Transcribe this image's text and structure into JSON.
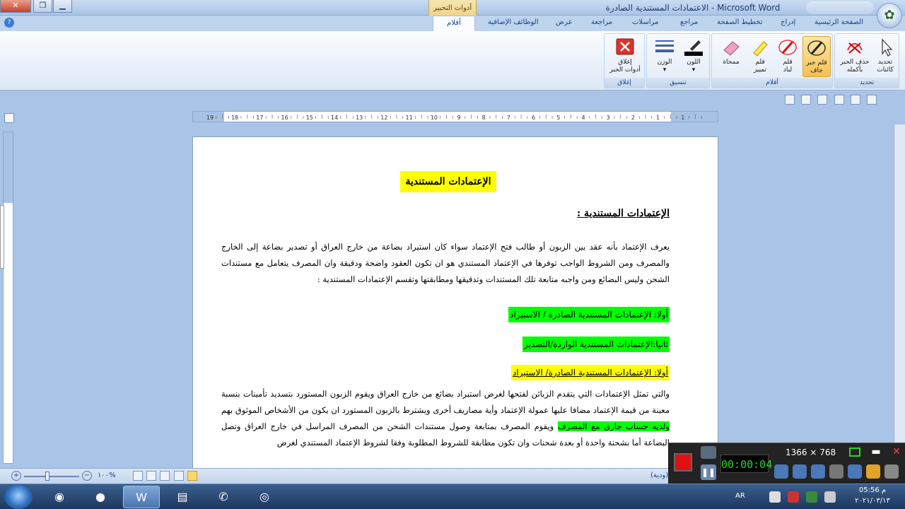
{
  "window": {
    "title": "الاعتمادات المستندية الصادرة - Microsoft Word",
    "close_glyph": "✕",
    "restore_glyph": "❐",
    "minimize_glyph": "▁",
    "contextual_group": "أدوات التحبير"
  },
  "ribbon": {
    "tabs": [
      {
        "label": "الصفحة الرئيسية"
      },
      {
        "label": "إدراج"
      },
      {
        "label": "تخطيط الصفحة"
      },
      {
        "label": "مراجع"
      },
      {
        "label": "مراسلات"
      },
      {
        "label": "مراجعة"
      },
      {
        "label": "عرض"
      },
      {
        "label": "الوظائف الإضافية"
      }
    ],
    "active_tab": "أقلام",
    "groups": {
      "select": {
        "label": "تحديد",
        "buttons": [
          {
            "label_1": "تحديد",
            "label_2": "كائنات",
            "icon": "arrow-select-icon"
          },
          {
            "label_1": "حذف الحبر",
            "label_2": "بأكمله",
            "icon": "erase-ink-icon"
          }
        ]
      },
      "pens": {
        "label": "أقلام",
        "buttons": [
          {
            "label_1": "قلم حبر",
            "label_2": "جاف",
            "icon": "ballpoint-pen-icon",
            "active": true
          },
          {
            "label_1": "قلم",
            "label_2": "لباد",
            "icon": "felt-pen-icon"
          },
          {
            "label_1": "قلم",
            "label_2": "تمييز",
            "icon": "highlighter-icon"
          },
          {
            "label_1": "ممحاة",
            "label_2": "",
            "icon": "eraser-icon"
          }
        ]
      },
      "format": {
        "label": "تنسيق",
        "buttons": [
          {
            "label_1": "اللون",
            "label_2": "▾",
            "icon": "color-icon"
          },
          {
            "label_1": "الوزن",
            "label_2": "▾",
            "icon": "weight-icon"
          }
        ]
      },
      "close": {
        "label": "إغلاق",
        "buttons": [
          {
            "label_1": "إغلاق",
            "label_2": "أدوات الحبر",
            "icon": "close-red-icon"
          }
        ]
      }
    }
  },
  "ruler": {
    "labels": [
      "19",
      "18",
      "17",
      "16",
      "15",
      "14",
      "13",
      "12",
      "11",
      "10",
      "9",
      "8",
      "7",
      "6",
      "5",
      "4",
      "3",
      "2",
      "1",
      "1"
    ]
  },
  "document": {
    "title": "الإعتمادات المستندية",
    "subtitle": "الإعتمادات المستندية :",
    "para1": "يعرف الإعتماد بأنه عقد بين الزبون أو طالب فتح الإعتماد سواء كان استيراد بضاعة من خارج العراق أو تصدير بضاعة إلى الخارج والمصرف ومن الشروط الواجب توفرها في الإعتماد المستندي هو ان تكون العقود واضحة ودقيقة وان المصرف يتعامل مع مستندات الشحن وليس البضائع ومن واجبه متابعة تلك المستندات وتدقيقها ومطابقتها وتقسم الإعتمادات المستندية :",
    "item1": "أولا: الإعتمادات المستندية الصادرة / الاستيراد",
    "item2": "ثانيا:الإعتمادات المستندية الواردة/التصدير",
    "item3": "أولا: الإعتمادات المستندية الصادرة/ الاستيراد",
    "para2_a": "والتي تمثل الإعتمادات التي يتقدم الزبائن لفتحها لغرض استيراد بضائع من خارج العراق ويقوم الزبون المستورد بتسديد تأمينات بنسبة معينة من قيمة الإعتماد مضافا عليها عمولة الإعتماد وأية مصاريف أخرى ويشترط بالزبون المستورد ان يكون من الأشخاص الموثوق بهم ",
    "para2_mark": "ولديه حساب جاري مع المصرف",
    "para2_b": " ويقوم المصرف بمتابعة وصول مستندات الشحن من المصرف المراسل في خارج العراق وتصل البضاعة أما بشحنة واحدة أو بعدة شحنات وان تكون مطابقة للشروط المطلوبة وفقا لشروط الإعتماد المستندي لغرض"
  },
  "statusbar": {
    "zoom": "١٠٠%",
    "zoom_minus": "−",
    "zoom_plus": "+",
    "language": "(ودية)"
  },
  "recorder": {
    "timer": "00:00:04",
    "resolution": "1366 × 768",
    "pause_glyph": "❚❚",
    "minimize_glyph": "▬",
    "close_glyph": "✕"
  },
  "taskbar": {
    "language": "AR",
    "time": "05:56 م",
    "date": "٢٠٢١/٠٣/١٣"
  },
  "colors": {
    "highlight_yellow": "#ffff00",
    "highlight_green": "#00ff00",
    "ribbon_active": "#f6c052"
  }
}
